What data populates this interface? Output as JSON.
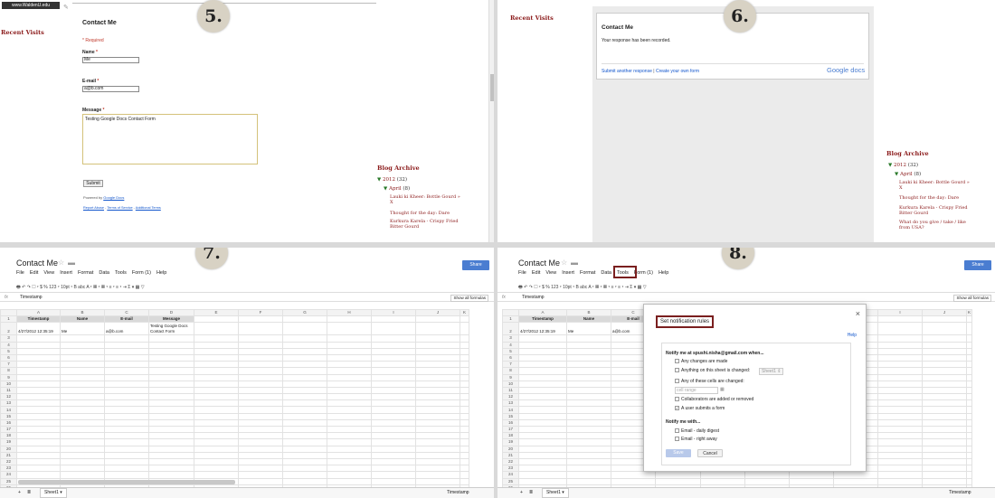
{
  "steps": {
    "s5": "5.",
    "s6": "6.",
    "s7": "7.",
    "s8": "8."
  },
  "blog": {
    "top_link": "www.WaldenU.edu",
    "recent_visits": "Recent Visits",
    "archive_title": "Blog Archive",
    "year": "2012",
    "year_count": "(32)",
    "month": "April",
    "month_count": "(8)",
    "posts": [
      "Lauki ki Kheer: Bottle Gourd » X",
      "Thought for the day: Dare",
      "Kurkura Karela - Crispy Fried Bitter Gourd",
      "What do you give / take / like from USA?"
    ]
  },
  "form": {
    "title": "Contact Me",
    "required": "* Required",
    "name_label": "Name",
    "name_value": "Me",
    "email_label": "E-mail",
    "email_value": "a@b.com",
    "message_label": "Message",
    "message_value": "Testing Google Docs Contact Form",
    "submit": "Submit",
    "powered_by": "Powered by",
    "google_docs": "Google Docs",
    "report_abuse": "Report Abuse",
    "terms": "Terms of Service",
    "additional_terms": "Additional Terms"
  },
  "confirm": {
    "title": "Contact Me",
    "message": "Your response has been recorded.",
    "submit_another": "Submit another response",
    "sep": "|",
    "create_own": "Create your own form",
    "logo": "Google docs"
  },
  "sheet": {
    "title": "Contact Me",
    "share": "Share",
    "menus": [
      "File",
      "Edit",
      "View",
      "Insert",
      "Format",
      "Data",
      "Tools",
      "Form (1)",
      "Help"
    ],
    "toolbar_text": "🖶  ↶  ↷  ▢   ▾   $   %   123 ▾   10pt ▾   B   abc   A ▾   ▦ ▾   ▦ ▾   ≡ ▾   ≡ ▾   ⇥   Σ ▾   ▦   ▽",
    "fx": "fx",
    "cell_ref": "Timestamp",
    "show_formulas": "Show all formulas",
    "col_letters": [
      "A",
      "B",
      "C",
      "D",
      "E",
      "F",
      "G",
      "H",
      "I",
      "J",
      "K"
    ],
    "headers": [
      "Timestamp",
      "Name",
      "E-mail",
      "Message"
    ],
    "row2": [
      "4/27/2012 12:35:19",
      "Me",
      "a@b.com",
      "Testing Google Docs Contact Form"
    ],
    "row_numbers": [
      "1",
      "2",
      "3",
      "4",
      "5",
      "6",
      "7",
      "8",
      "9",
      "10",
      "11",
      "12",
      "13",
      "14",
      "15",
      "16",
      "17",
      "18",
      "19",
      "20",
      "21",
      "22",
      "23",
      "24",
      "25",
      "26"
    ],
    "sheet_tab": "Sheet1",
    "status": "Timestamp"
  },
  "dialog": {
    "title": "Set notification rules",
    "close": "×",
    "help": "Help",
    "notify_me_at": "Notify me at spushi.nisha@gmail.com when...",
    "options": [
      "Any changes are made",
      "Anything on this sheet is changed:",
      "Any of these cells are changed:",
      "Collaborators are added or removed",
      "A user submits a form"
    ],
    "sheet_select": "Sheet1",
    "cell_range": "cell range",
    "notify_with": "Notify me with...",
    "with_options": [
      "Email - daily digest",
      "Email - right away"
    ],
    "save": "Save",
    "cancel": "Cancel",
    "checked_option": "A user submits a form"
  }
}
